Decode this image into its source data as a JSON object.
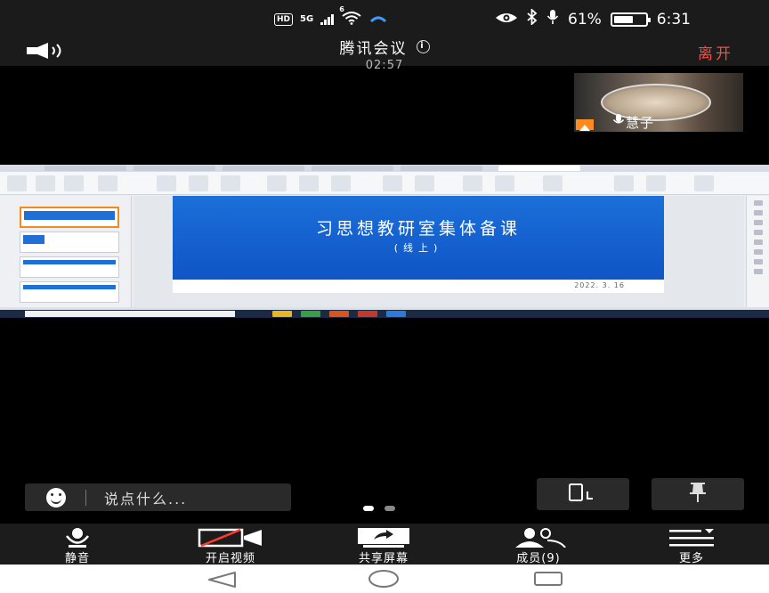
{
  "status_bar": {
    "hd_badge": "HD",
    "network": "5G",
    "wifi_badge": "6",
    "battery_percent": 61,
    "battery_text": "61%",
    "time": "6:31",
    "icons": [
      "eye-icon",
      "bluetooth-icon",
      "mic-icon"
    ]
  },
  "header": {
    "title": "腾讯会议",
    "timer": "02:57",
    "leave_label": "离开"
  },
  "participant": {
    "name": "慧子"
  },
  "shared_screen": {
    "slide_title": "习思想教研室集体备课",
    "slide_subtitle": "(线上)",
    "slide_date": "2022. 3. 16"
  },
  "chat": {
    "placeholder": "说点什么..."
  },
  "toolbar": {
    "mute_label": "静音",
    "video_label": "开启视频",
    "share_label": "共享屏幕",
    "members_label": "成员(9)",
    "more_label": "更多"
  },
  "colors": {
    "leave": "#ff4a3d",
    "slide_blue": "#1c6fd9",
    "host_badge": "#ff8a1f"
  }
}
